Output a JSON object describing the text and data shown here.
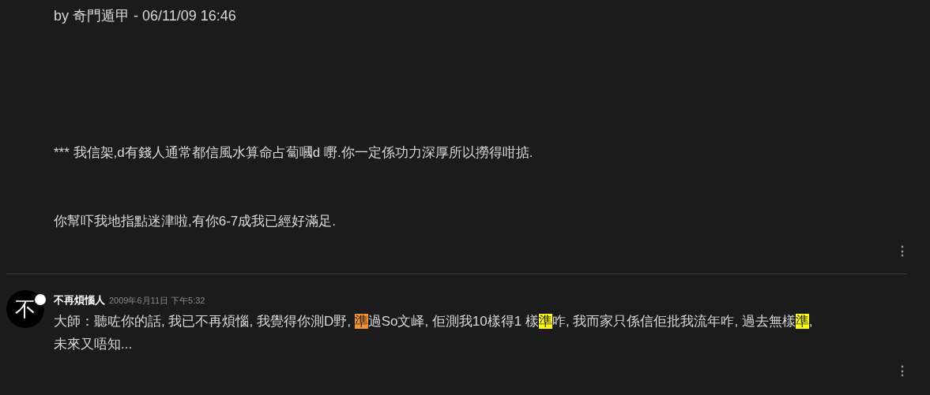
{
  "post": {
    "byline": "by 奇門遁甲 - 06/11/09 16:46",
    "paragraphs": [
      "*** 我信架,d有錢人通常都信風水算命占蔔嘓d 嘢.你一定係功力深厚所以撈得咁掂.",
      "你幫吓我地指點迷津啦,有你6-7成我已經好滿足."
    ],
    "menu": "⋮"
  },
  "comment": {
    "avatar": "不",
    "online": true,
    "author": "不再煩惱人",
    "date": "2009年6月11日 下午5:32",
    "lines": [
      [
        {
          "text": "大師：聽咗你的話, 我已不再煩惱, 我覺得你測D野, "
        },
        {
          "text": "準",
          "color": "#f5922f"
        },
        {
          "text": "過So文峄, 佢測我10樣得1 樣"
        },
        {
          "text": "準",
          "color": "#ffff00"
        },
        {
          "text": "咋, 我而家只係信佢批我流年咋, 過去無樣"
        },
        {
          "text": "準",
          "color": "#ffff00"
        },
        {
          "text": ","
        }
      ],
      [
        {
          "text": "未來又唔知..."
        }
      ]
    ],
    "menu": "⋮"
  }
}
